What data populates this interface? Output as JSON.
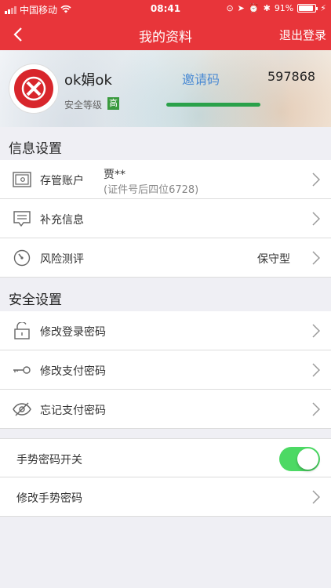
{
  "status_bar": {
    "carrier": "中国移动",
    "time": "08:41",
    "battery_percent": "91%",
    "battery_level": 0.91
  },
  "nav": {
    "title": "我的资料",
    "logout_label": "退出登录",
    "back_icon": "chevron-left-icon"
  },
  "profile": {
    "username": "ok娟ok",
    "security_label": "安全等级",
    "security_level": "高",
    "invite_label": "邀请码",
    "invite_code": "597868",
    "security_progress": 1.0,
    "accent_color": "#e8353a",
    "progress_color": "#2aa14a"
  },
  "info_settings": {
    "header": "信息设置",
    "custody": {
      "label": "存管账户",
      "name": "贾**",
      "id_hint": "(证件号后四位6728)",
      "icon": "safe-icon"
    },
    "supplement": {
      "label": "补充信息",
      "icon": "message-icon"
    },
    "risk": {
      "label": "风险测评",
      "value": "保守型",
      "icon": "gauge-icon"
    }
  },
  "security_settings": {
    "header": "安全设置",
    "login_pwd": {
      "label": "修改登录密码",
      "icon": "unlock-icon"
    },
    "pay_pwd": {
      "label": "修改支付密码",
      "icon": "key-icon"
    },
    "forgot_pay_pwd": {
      "label": "忘记支付密码",
      "icon": "eye-slash-icon"
    }
  },
  "gesture": {
    "switch_label": "手势密码开关",
    "switch_on": true,
    "switch_color": "#4cd964",
    "modify_label": "修改手势密码"
  }
}
